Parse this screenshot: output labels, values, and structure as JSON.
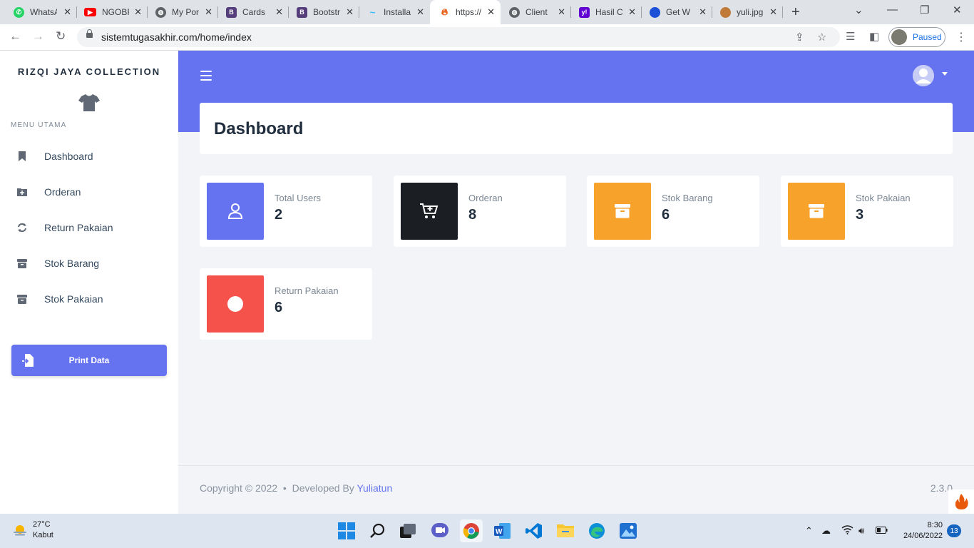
{
  "browser": {
    "tabs": [
      {
        "title": "WhatsApp",
        "icon": "whatsapp-icon",
        "color": "#25d366"
      },
      {
        "title": "NGOBRAS",
        "icon": "youtube-icon",
        "color": "#ff0000"
      },
      {
        "title": "My Portfolio",
        "icon": "globe-icon",
        "color": "#5f6368"
      },
      {
        "title": "Cards",
        "icon": "bootstrap-icon",
        "color": "#563d7c"
      },
      {
        "title": "Bootstrap",
        "icon": "bootstrap-icon",
        "color": "#563d7c"
      },
      {
        "title": "Installation",
        "icon": "tailwind-icon",
        "color": "#38bdf8"
      },
      {
        "title": "https://",
        "icon": "flame-icon",
        "color": "#e8590c"
      },
      {
        "title": "Client",
        "icon": "globe-icon",
        "color": "#5f6368"
      },
      {
        "title": "Hasil C",
        "icon": "yahoo-icon",
        "color": "#6001d2"
      },
      {
        "title": "Get W",
        "icon": "edge-icon",
        "color": "#1a4fd6"
      },
      {
        "title": "yuli.jpg",
        "icon": "image-icon",
        "color": "#c07a3a"
      }
    ],
    "url": "sistemtugasakhir.com/home/index",
    "profile_status": "Paused"
  },
  "sidebar": {
    "brand": "RIZQI JAYA COLLECTION",
    "menu_heading": "MENU UTAMA",
    "items": [
      {
        "label": "Dashboard",
        "icon": "bookmark-icon"
      },
      {
        "label": "Orderan",
        "icon": "folder-plus-icon"
      },
      {
        "label": "Return Pakaian",
        "icon": "refresh-icon"
      },
      {
        "label": "Stok Barang",
        "icon": "archive-icon"
      },
      {
        "label": "Stok Pakaian",
        "icon": "archive-icon"
      }
    ],
    "print_button": "Print Data"
  },
  "main": {
    "page_title": "Dashboard",
    "stats": [
      {
        "label": "Total Users",
        "value": "2",
        "color": "#6573f0",
        "icon": "user-icon"
      },
      {
        "label": "Orderan",
        "value": "8",
        "color": "#1b1e22",
        "icon": "cart-plus-icon"
      },
      {
        "label": "Stok Barang",
        "value": "6",
        "color": "#f7a22b",
        "icon": "archive-icon"
      },
      {
        "label": "Stok Pakaian",
        "value": "3",
        "color": "#f7a22b",
        "icon": "archive-icon"
      },
      {
        "label": "Return Pakaian",
        "value": "6",
        "color": "#f5524b",
        "icon": "circle-icon"
      }
    ]
  },
  "footer": {
    "copyright": "Copyright © 2022",
    "developed_by": "Developed By",
    "author": "Yuliatun",
    "version": "2.3.0"
  },
  "taskbar": {
    "temperature": "27°C",
    "weather": "Kabut",
    "time": "8:30",
    "date": "24/06/2022",
    "notifications": "13"
  }
}
